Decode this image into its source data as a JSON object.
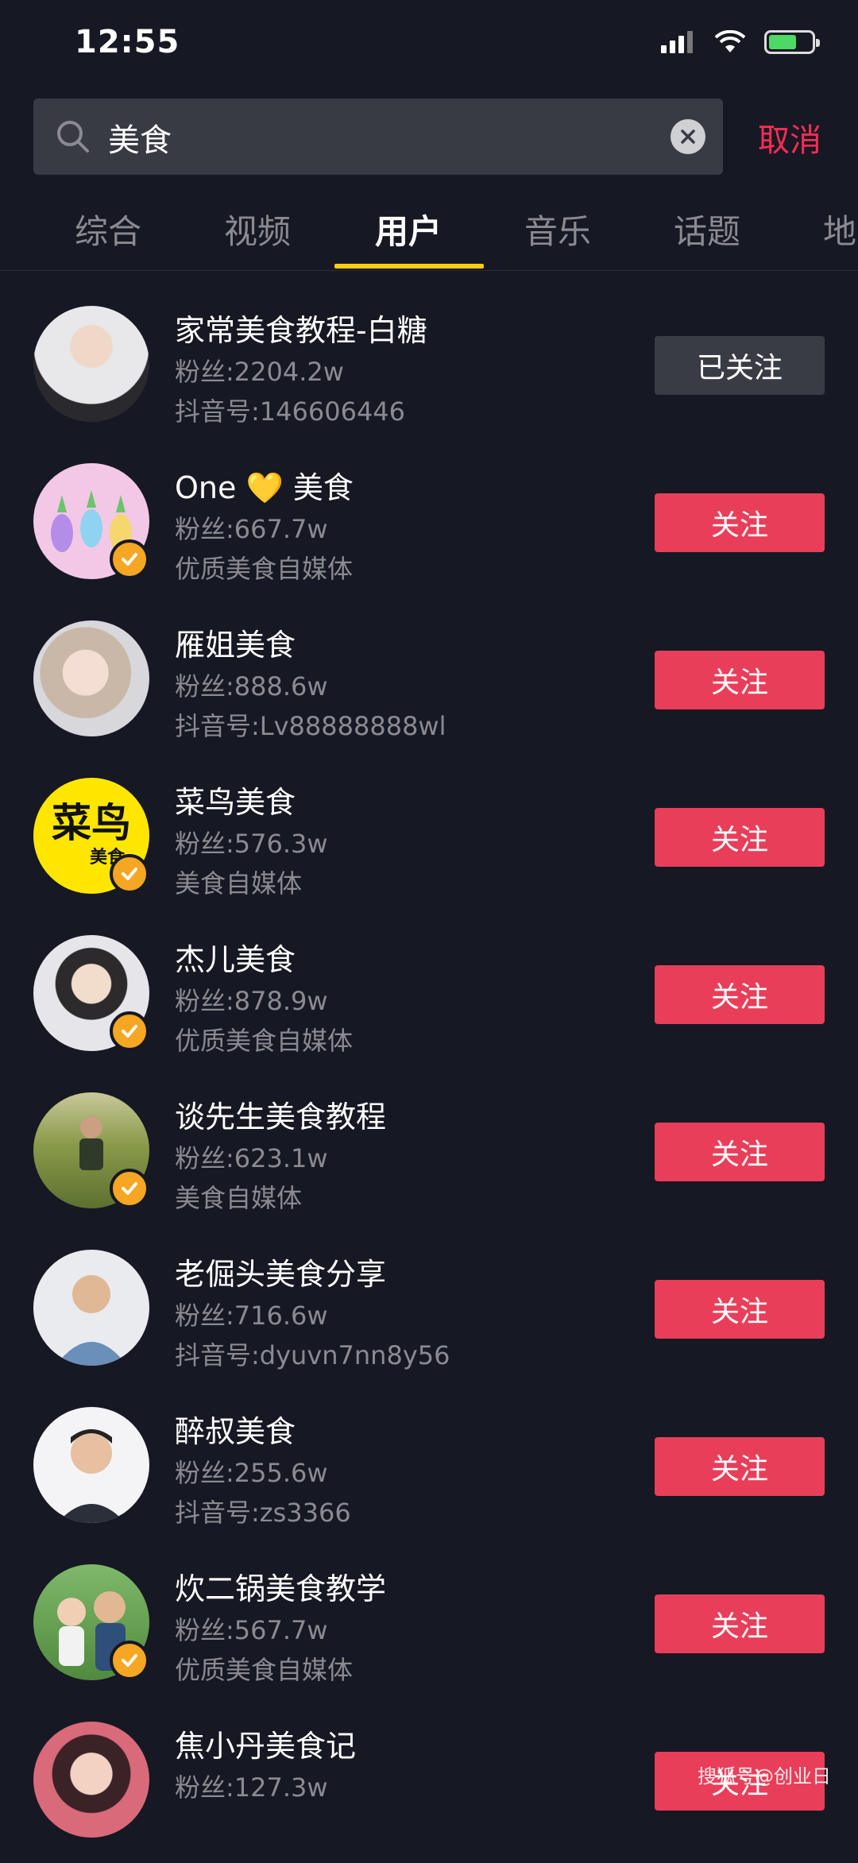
{
  "status": {
    "time": "12:55"
  },
  "search": {
    "query": "美食",
    "cancel_label": "取消"
  },
  "tabs": [
    {
      "label": "综合"
    },
    {
      "label": "视频"
    },
    {
      "label": "用户"
    },
    {
      "label": "音乐"
    },
    {
      "label": "话题"
    },
    {
      "label": "地"
    }
  ],
  "active_tab": "用户",
  "users": [
    {
      "name": "家常美食教程-白糖",
      "fans": "粉丝:2204.2w",
      "sub": "抖音号:146606446",
      "button": "已关注",
      "followed": true,
      "verified": false
    },
    {
      "name": "One 💛 美食",
      "fans": "粉丝:667.7w",
      "sub": "优质美食自媒体",
      "button": "关注",
      "followed": false,
      "verified": true
    },
    {
      "name": "雁姐美食",
      "fans": "粉丝:888.6w",
      "sub": "抖音号:Lv88888888wl",
      "button": "关注",
      "followed": false,
      "verified": false
    },
    {
      "name": "菜鸟美食",
      "fans": "粉丝:576.3w",
      "sub": "美食自媒体",
      "button": "关注",
      "followed": false,
      "verified": true,
      "avatar_text": "菜鸟",
      "avatar_subtext": "美食"
    },
    {
      "name": "杰儿美食",
      "fans": "粉丝:878.9w",
      "sub": "优质美食自媒体",
      "button": "关注",
      "followed": false,
      "verified": true
    },
    {
      "name": "谈先生美食教程",
      "fans": "粉丝:623.1w",
      "sub": "美食自媒体",
      "button": "关注",
      "followed": false,
      "verified": true
    },
    {
      "name": "老倔头美食分享",
      "fans": "粉丝:716.6w",
      "sub": "抖音号:dyuvn7nn8y56",
      "button": "关注",
      "followed": false,
      "verified": false
    },
    {
      "name": "醉叔美食",
      "fans": "粉丝:255.6w",
      "sub": "抖音号:zs3366",
      "button": "关注",
      "followed": false,
      "verified": false
    },
    {
      "name": "炊二锅美食教学",
      "fans": "粉丝:567.7w",
      "sub": "优质美食自媒体",
      "button": "关注",
      "followed": false,
      "verified": true
    },
    {
      "name": "焦小丹美食记",
      "fans": "粉丝:127.3w",
      "sub": "",
      "button": "关注",
      "followed": false,
      "verified": false
    }
  ],
  "watermark": "搜狐号@创业日",
  "colors": {
    "background": "#161823",
    "accent": "#fe2c55",
    "follow": "#e93e59",
    "tab_indicator": "#facc15",
    "verified": "#f5a623"
  }
}
